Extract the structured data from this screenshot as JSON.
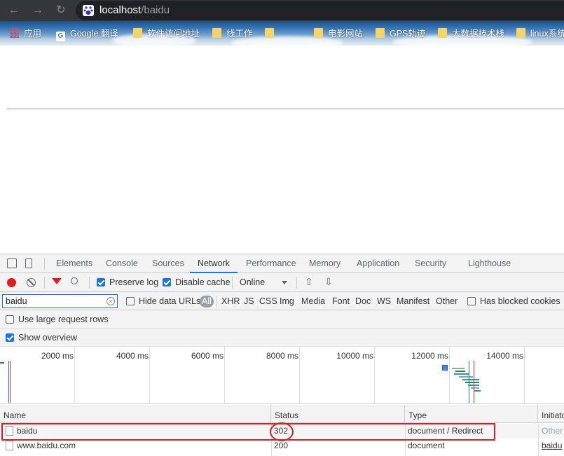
{
  "browser": {
    "url_host": "localhost",
    "url_path": "/baidu",
    "bookmarks": [
      {
        "label": "应用",
        "icon": "apps-icon"
      },
      {
        "label": "Google 翻译",
        "icon": "google-translate-icon"
      },
      {
        "label": "软件访问地址",
        "icon": "folder-icon"
      },
      {
        "label": "线工作",
        "icon": "folder-icon"
      },
      {
        "label": "",
        "icon": "folder-icon"
      },
      {
        "label": "电影网站",
        "icon": "folder-icon"
      },
      {
        "label": "GPS轨迹",
        "icon": "folder-icon"
      },
      {
        "label": "大数据技术栈",
        "icon": "folder-icon"
      },
      {
        "label": "linux系统",
        "icon": "folder-icon"
      }
    ]
  },
  "devtools": {
    "tabs": [
      "Elements",
      "Console",
      "Sources",
      "Network",
      "Performance",
      "Memory",
      "Application",
      "Security",
      "Lighthouse"
    ],
    "active_tab": "Network",
    "toolbar": {
      "preserve_log": "Preserve log",
      "disable_cache": "Disable cache",
      "throttle": "Online"
    },
    "filter": {
      "value": "baidu",
      "hide_data_urls": "Hide data URLs",
      "types": [
        "All",
        "XHR",
        "JS",
        "CSS",
        "Img",
        "Media",
        "Font",
        "Doc",
        "WS",
        "Manifest",
        "Other"
      ],
      "has_blocked_cookies": "Has blocked cookies"
    },
    "options": {
      "large_rows": "Use large request rows",
      "show_overview": "Show overview"
    },
    "overview_ticks": [
      "2000 ms",
      "4000 ms",
      "6000 ms",
      "8000 ms",
      "10000 ms",
      "12000 ms",
      "14000 ms"
    ],
    "columns": [
      "Name",
      "Status",
      "Type",
      "Initiator"
    ],
    "rows": [
      {
        "name": "baidu",
        "status": "302",
        "type": "document / Redirect",
        "initiator": "Other"
      },
      {
        "name": "www.baidu.com",
        "status": "200",
        "type": "document",
        "initiator": "baidu"
      }
    ],
    "colors": {
      "accent": "#1a73e8",
      "record": "#e21b1b",
      "highlight": "#e02020"
    }
  }
}
